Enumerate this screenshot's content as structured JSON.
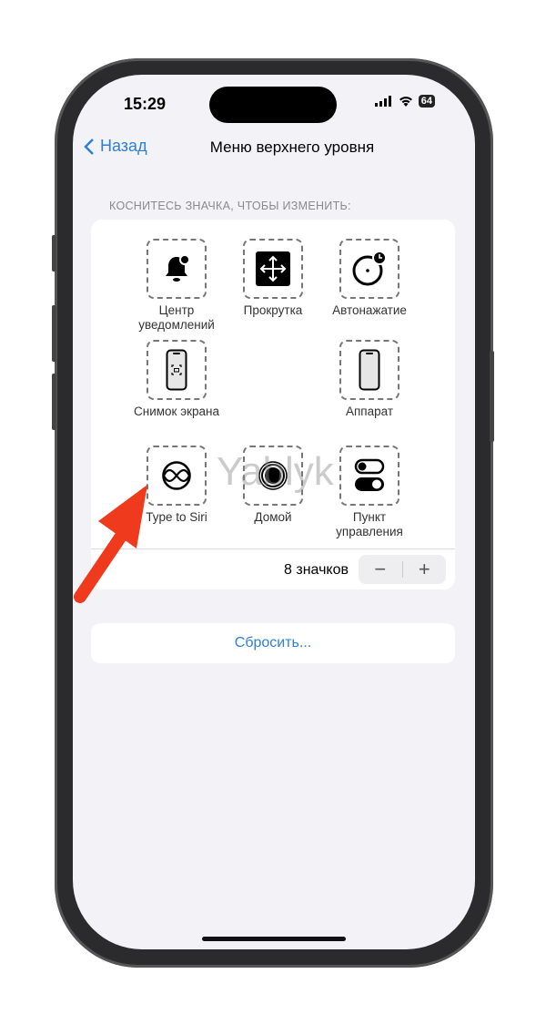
{
  "status_bar": {
    "time": "15:29",
    "battery": "64"
  },
  "nav": {
    "back_label": "Назад",
    "title": "Меню верхнего уровня"
  },
  "section_hint": "КОСНИТЕСЬ ЗНАЧКА, ЧТОБЫ ИЗМЕНИТЬ:",
  "icons": [
    {
      "label": "Центр уведомлений",
      "icon": "bell-icon"
    },
    {
      "label": "Прокрутка",
      "icon": "scroll-arrows-icon"
    },
    {
      "label": "Автонажатие",
      "icon": "dwell-clock-icon"
    },
    {
      "label": "Снимок экрана",
      "icon": "screenshot-icon"
    },
    {
      "label": "Аппарат",
      "icon": "device-icon"
    },
    {
      "label": "Type to Siri",
      "icon": "siri-icon"
    },
    {
      "label": "Домой",
      "icon": "home-button-icon"
    },
    {
      "label": "Пункт управления",
      "icon": "control-center-icon"
    }
  ],
  "counter": {
    "text": "8 значков",
    "minus": "−",
    "plus": "+"
  },
  "reset_label": "Сбросить...",
  "watermark": "Yablyk",
  "colors": {
    "accent": "#2f7fd3",
    "arrow": "#f03a1e",
    "background": "#f2f2f7"
  }
}
